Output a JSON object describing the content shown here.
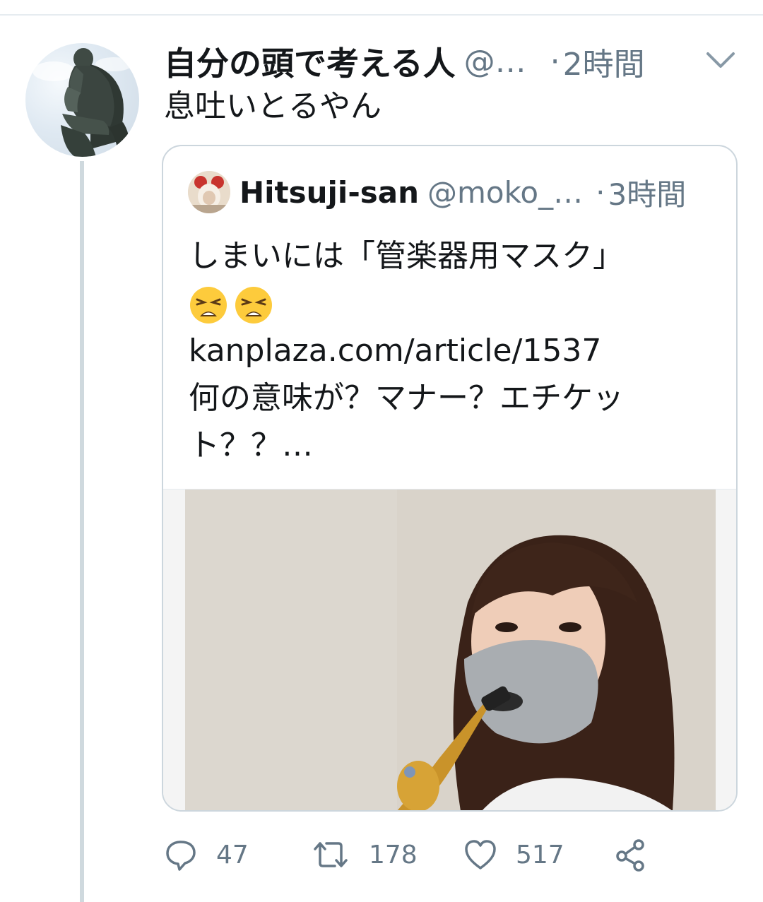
{
  "tweet": {
    "display_name": "自分の頭で考える人",
    "handle": "@…",
    "separator": "·",
    "time": "2時間",
    "text": "息吐いとるやん",
    "avatar_icon": "thinker-statue-avatar",
    "menu_icon": "chevron-down-icon"
  },
  "quote": {
    "display_name": "Hitsuji-san",
    "handle": "@moko_…",
    "separator": "·",
    "time": "3時間",
    "lines": [
      "しまいには「管楽器用マスク」",
      "kanplaza.com/article/1537",
      "何の意味が？マナー？エチケッ",
      "ト？？…"
    ],
    "emojis": [
      "weary-face-emoji",
      "weary-face-emoji"
    ],
    "media": "woman-with-mask-playing-saxophone-photo"
  },
  "actions": {
    "reply": {
      "icon": "reply-icon",
      "count": "47"
    },
    "retweet": {
      "icon": "retweet-icon",
      "count": "178"
    },
    "like": {
      "icon": "heart-icon",
      "count": "517"
    },
    "share": {
      "icon": "share-icon"
    }
  },
  "colors": {
    "text": "#14171a",
    "secondary": "#657786",
    "border": "#ccd6dd",
    "thread_line": "#cfd9de"
  }
}
